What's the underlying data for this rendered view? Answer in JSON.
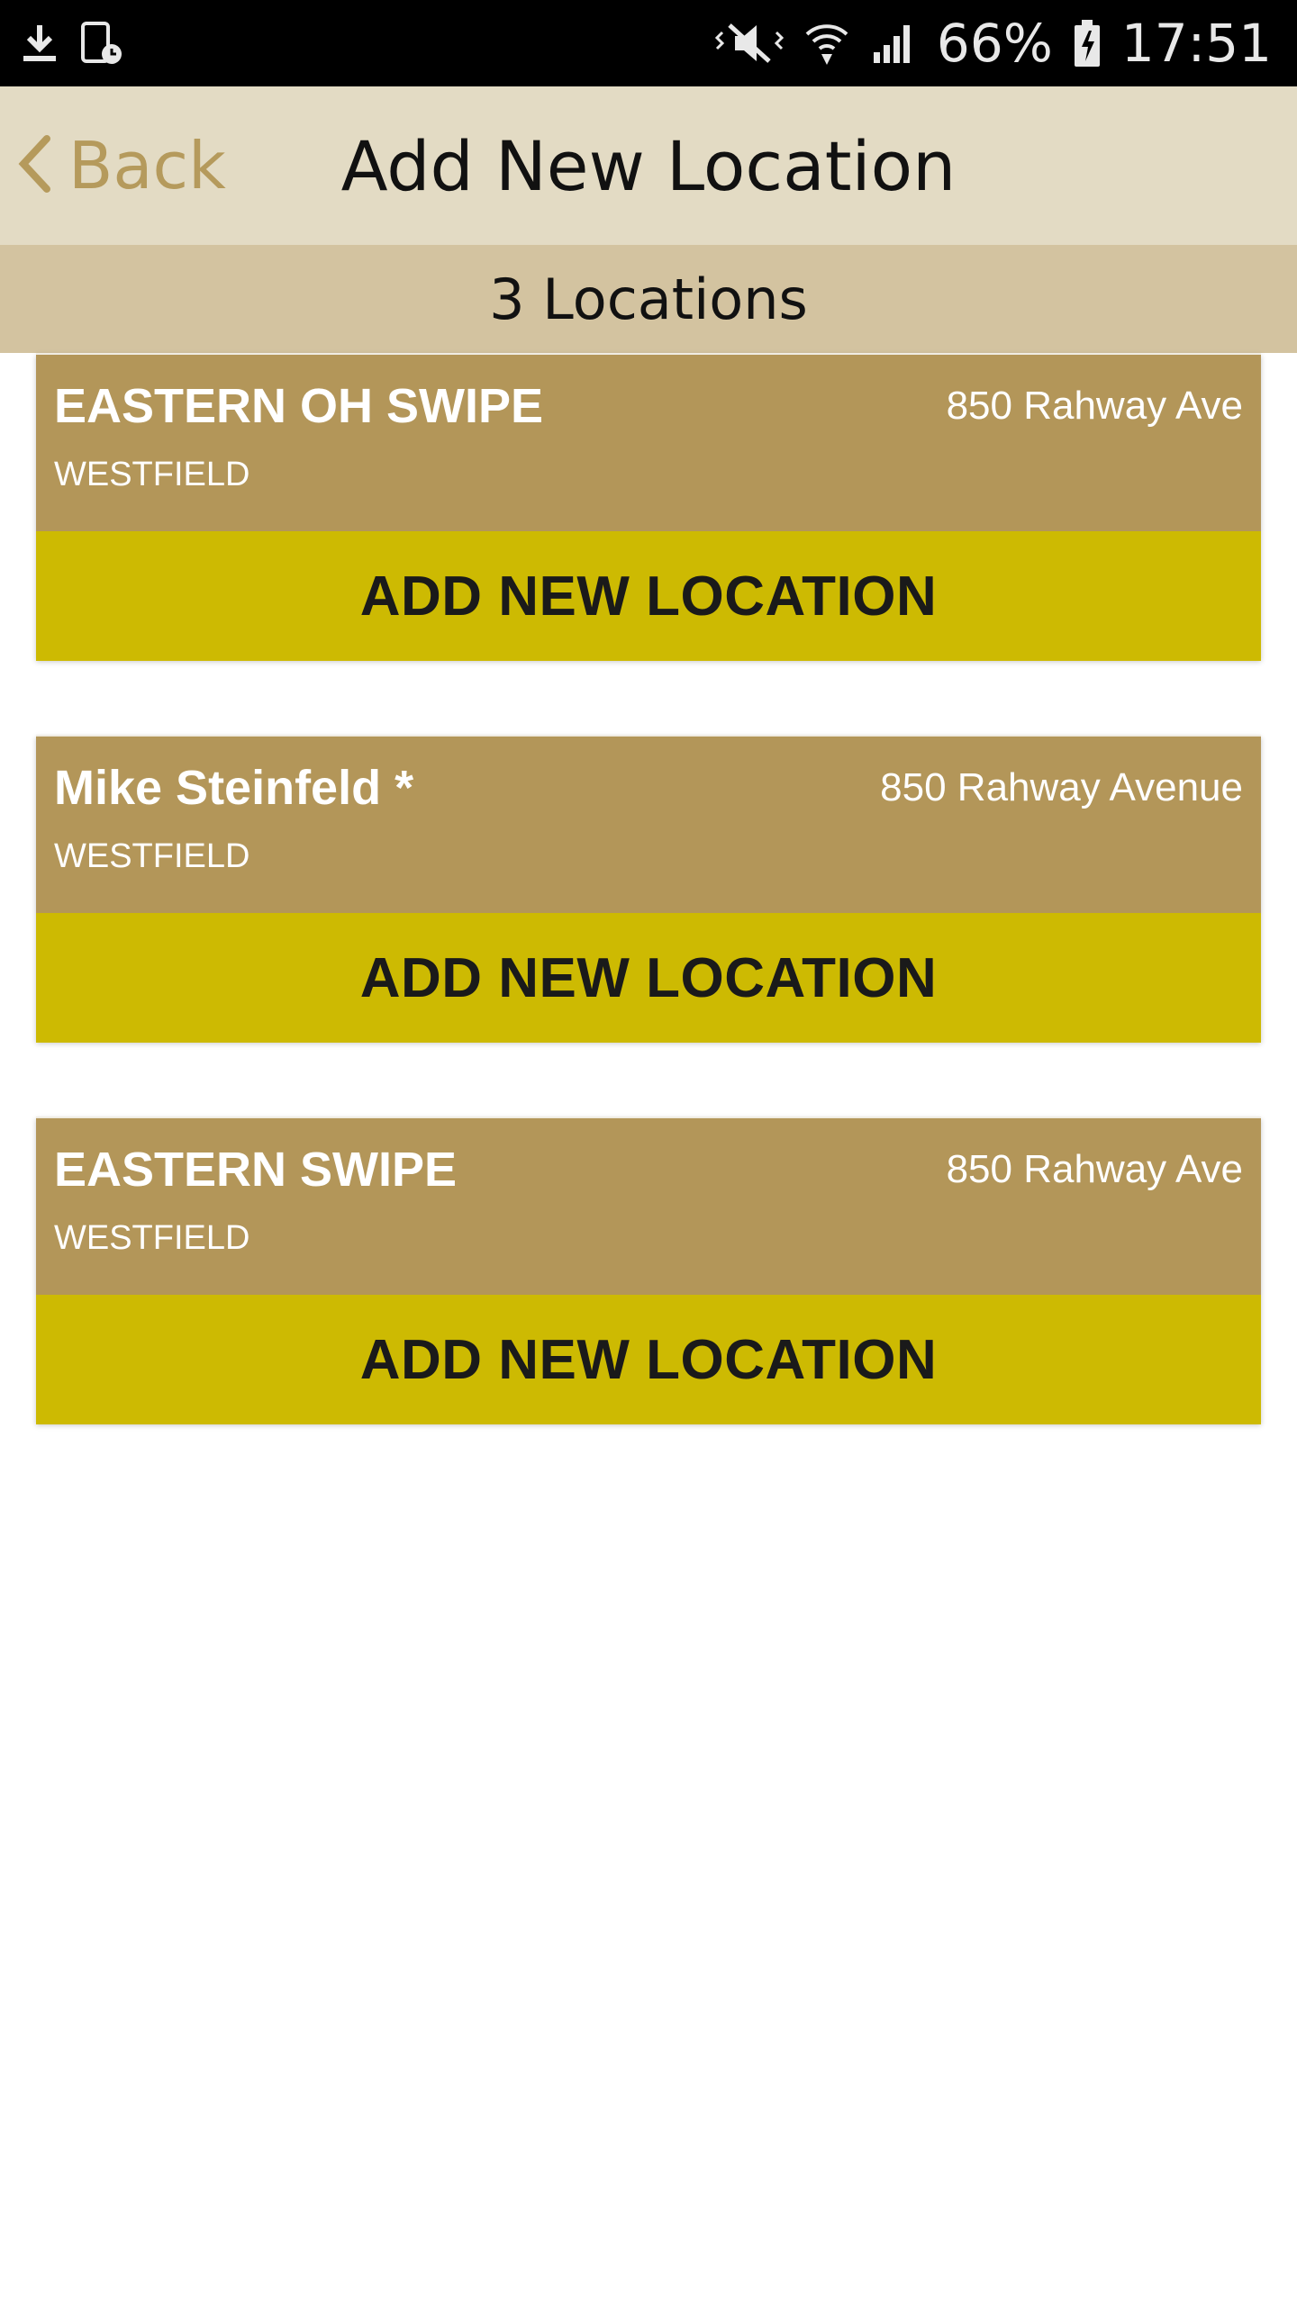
{
  "status_bar": {
    "left_icons": [
      "download-icon",
      "device-clock-icon"
    ],
    "right_icons": [
      "mute-vibrate-icon",
      "wifi-icon",
      "signal-icon",
      "battery-charging-icon"
    ],
    "battery_percent": "66%",
    "time": "17:51"
  },
  "header": {
    "back_label": "Back",
    "title": "Add New Location"
  },
  "count_bar": {
    "text": "3 Locations"
  },
  "locations": [
    {
      "name": "EASTERN OH SWIPE",
      "address": "850 Rahway Ave",
      "city": "WESTFIELD",
      "button_label": "ADD NEW LOCATION"
    },
    {
      "name": "Mike Steinfeld *",
      "address": "850 Rahway Avenue",
      "city": "WESTFIELD",
      "button_label": "ADD NEW LOCATION"
    },
    {
      "name": "EASTERN SWIPE",
      "address": "850 Rahway Ave",
      "city": "WESTFIELD",
      "button_label": "ADD NEW LOCATION"
    }
  ],
  "colors": {
    "header_bg": "#e3dbc4",
    "count_bar_bg": "#d3c3a0",
    "card_info_bg": "#b39659",
    "card_button_bg": "#cdba02",
    "back_accent": "#b59a5c"
  }
}
